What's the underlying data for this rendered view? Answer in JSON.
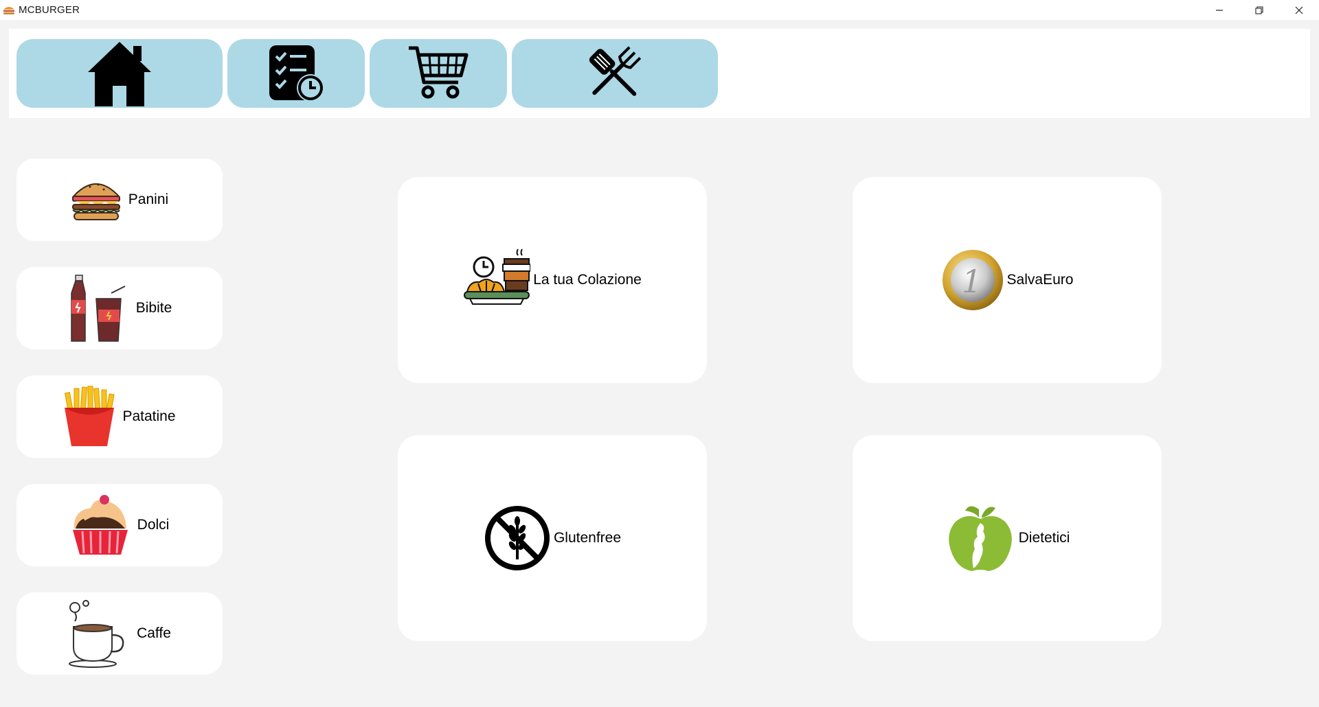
{
  "window": {
    "title": "MCBURGER",
    "icons": [
      "burger-icon",
      "minimize-icon",
      "restore-icon",
      "close-icon"
    ]
  },
  "toolbar": {
    "buttons": [
      {
        "name": "home",
        "icon": "house-icon"
      },
      {
        "name": "orders",
        "icon": "checklist-clock-icon"
      },
      {
        "name": "cart",
        "icon": "shopping-cart-icon"
      },
      {
        "name": "kitchen",
        "icon": "spatula-fork-icon"
      }
    ]
  },
  "sidebar": {
    "items": [
      {
        "label": "Panini",
        "icon": "hamburger-icon"
      },
      {
        "label": "Bibite",
        "icon": "soda-drinks-icon"
      },
      {
        "label": "Patatine",
        "icon": "french-fries-icon"
      },
      {
        "label": "Dolci",
        "icon": "cupcake-icon"
      },
      {
        "label": "Caffe",
        "icon": "coffee-cup-icon"
      }
    ]
  },
  "main": {
    "cards": [
      {
        "label": "La tua Colazione",
        "icon": "breakfast-icon"
      },
      {
        "label": "SalvaEuro",
        "icon": "euro-coin-icon"
      },
      {
        "label": "Glutenfree",
        "icon": "no-gluten-icon"
      },
      {
        "label": "Dietetici",
        "icon": "diet-apple-icon"
      }
    ]
  },
  "colors": {
    "background": "#f3f3f3",
    "toolbar_button": "#add8e6",
    "card": "#ffffff"
  }
}
